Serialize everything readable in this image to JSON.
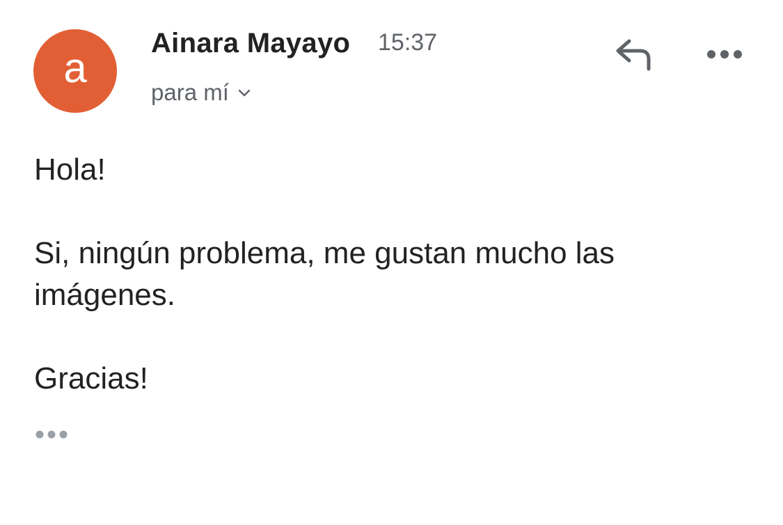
{
  "message": {
    "sender": {
      "avatar_letter": "a",
      "avatar_color": "#e25f35",
      "name": "Ainara Mayayo"
    },
    "time": "15:37",
    "recipient_label": "para mí",
    "icons": {
      "recipient_toggle": "chevron-down-icon",
      "reply": "reply-icon",
      "more": "more-options-icon",
      "trimmed": "ellipsis-icon"
    },
    "body": {
      "greeting": "Hola!",
      "paragraph": "Si, ningún problema, me gustan mucho las imágenes.",
      "closing": "Gracias!"
    }
  },
  "colors": {
    "text": "#222222",
    "secondary_text": "#5f6368",
    "icon": "#5f6368",
    "trimmed_dots": "#9aa0a6"
  }
}
